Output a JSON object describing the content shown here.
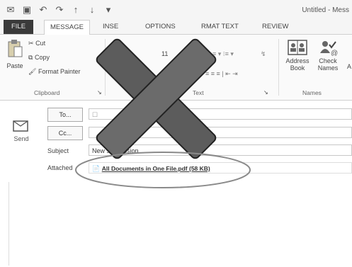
{
  "quick_access": {
    "icons": [
      "mail-icon",
      "save-icon",
      "undo-icon",
      "redo-icon",
      "up-arrow-icon",
      "down-arrow-icon",
      "customize-icon"
    ]
  },
  "window": {
    "title": "Untitled - Mess"
  },
  "tabs": [
    {
      "label": "FILE"
    },
    {
      "label": "MESSAGE"
    },
    {
      "label": "INSE"
    },
    {
      "label": "OPTIONS"
    },
    {
      "label": "RMAT TEXT"
    },
    {
      "label": "REVIEW"
    }
  ],
  "ribbon": {
    "clipboard": {
      "paste": "Paste",
      "cut": "Cut",
      "copy": "Copy",
      "format_painter": "Format Painter",
      "group_label": "Clipboard"
    },
    "basic_text": {
      "group_label": "Text"
    },
    "names": {
      "address_book_1": "Address",
      "address_book_2": "Book",
      "check_names_1": "Check",
      "check_names_2": "Names",
      "group_label": "Names"
    }
  },
  "compose": {
    "send_label": "Send",
    "to_label": "To...",
    "cc_label": "Cc...",
    "subject_label": "Subject",
    "subject_value": "New submission",
    "attached_label": "Attached",
    "attachment_name": "All Documents in One File.pdf (58 KB)"
  },
  "colors": {
    "file_tab": "#3a3a3a",
    "cross": "#6b6b6b",
    "ellipse": "#8a8a8a"
  }
}
